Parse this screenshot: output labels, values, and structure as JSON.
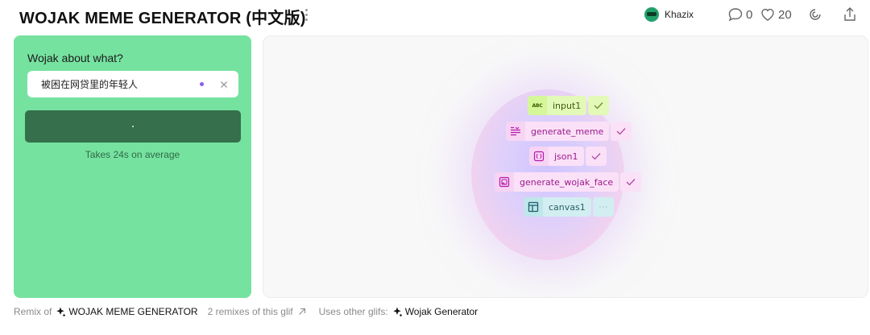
{
  "header": {
    "title": "WOJAK MEME GENERATOR (中文版)",
    "author": "Khazix",
    "comments": "0",
    "likes": "20"
  },
  "form": {
    "label": "Wojak about what?",
    "input_value": "被困在网贷里的年轻人",
    "run_note": "Takes 24s on average"
  },
  "graph": {
    "nodes": [
      {
        "type_badge": "ABC",
        "label": "input1",
        "status": "done"
      },
      {
        "type_badge": "text-icon",
        "label": "generate_meme",
        "status": "done"
      },
      {
        "type_badge": "braces-icon",
        "label": "json1",
        "status": "done"
      },
      {
        "type_badge": "image-icon",
        "label": "generate_wojak_face",
        "status": "done"
      },
      {
        "type_badge": "layout-icon",
        "label": "canvas1",
        "status": "running"
      }
    ]
  },
  "footer": {
    "remix_prefix": "Remix of",
    "remix_source": "WOJAK MEME GENERATOR",
    "remixes_link": "2 remixes of this glif",
    "uses_prefix": "Uses other glifs:",
    "uses_glif": "Wojak Generator"
  },
  "colors": {
    "panel_green": "#76e2a0",
    "button_green": "#356f4c",
    "accent_purple": "#8b5cf6"
  }
}
